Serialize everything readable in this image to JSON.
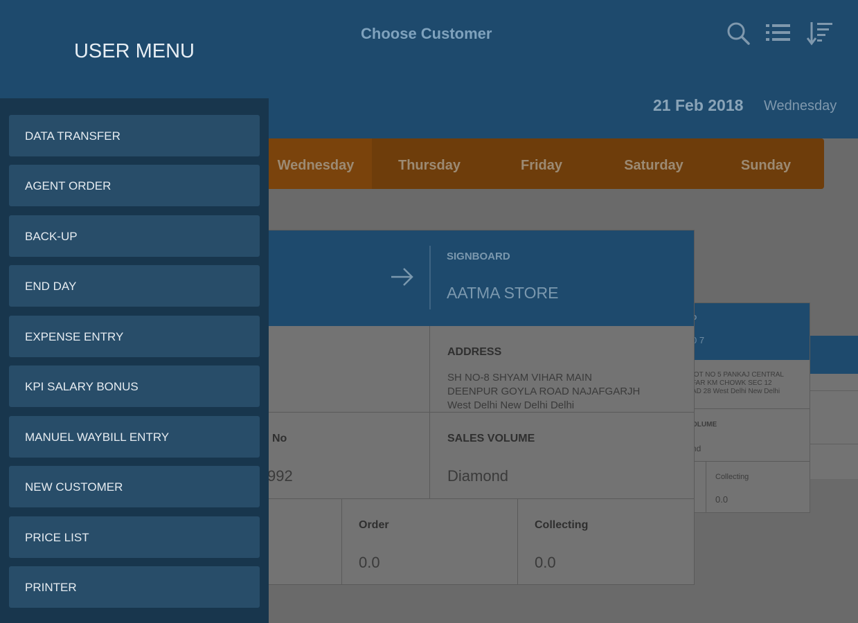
{
  "header": {
    "title": "Choose Customer",
    "date": "21 Feb 2018",
    "weekday": "Wednesday",
    "icons": [
      "search-icon",
      "list-icon",
      "sort-icon"
    ]
  },
  "days": [
    "Wednesday",
    "Thursday",
    "Friday",
    "Saturday",
    "Sunday"
  ],
  "card": {
    "signboard_label": "SIGNBOARD",
    "signboard_value": "AATMA STORE",
    "address_label": "ADDRESS",
    "address_lines": [
      "SH NO-8 SHYAM VIHAR MAIN",
      "DEENPUR GOYLA ROAD NAJAFGARJH",
      "West Delhi New Delhi Delhi"
    ],
    "no_label": "No",
    "no_value": "992",
    "sales_label": "SALES VOLUME",
    "sales_value": "Diamond",
    "order_label": "Order",
    "order_value": "0.0",
    "collecting_label": "Collecting",
    "collecting_value": "0.0"
  },
  "back_card": {
    "header_partial": "D",
    "header_value_partial": "0 7",
    "address_lines": [
      "IOT NO 5 PANKAJ CENTRAL",
      "FAR KM CHOWK SEC 12",
      "AD 28 West Delhi New Delhi"
    ],
    "sales_partial": "OLUME",
    "sales_value_partial": "nd",
    "collecting_label": "Collecting",
    "collecting_value": "0.0"
  },
  "user_menu": {
    "title": "USER MENU",
    "items": [
      "DATA TRANSFER",
      "AGENT ORDER",
      "BACK-UP",
      "END DAY",
      "EXPENSE ENTRY",
      "KPI SALARY BONUS",
      "MANUEL WAYBILL ENTRY",
      "NEW CUSTOMER",
      "PRICE LIST",
      "PRINTER"
    ]
  },
  "colors": {
    "header_blue": "#1e4a6d",
    "drawer_blue": "#18364d",
    "menu_item": "#284d69",
    "day_bar_orange": "#6e3d0b"
  }
}
